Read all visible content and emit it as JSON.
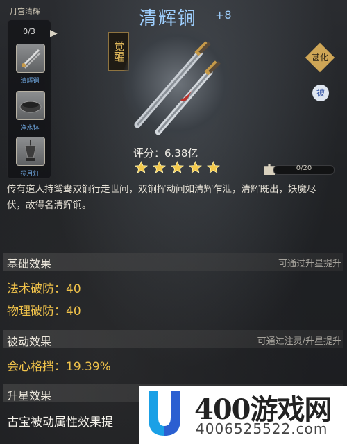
{
  "set": {
    "title": "月宫清辉",
    "count": "0/3",
    "items": [
      {
        "label": "清辉锏"
      },
      {
        "label": "净水钵"
      },
      {
        "label": "揽月灯"
      }
    ]
  },
  "item": {
    "name": "清辉锏",
    "level": "+8",
    "awaken_badge": "觉醒",
    "side_badge_1": "甚化",
    "side_badge_2": "被",
    "score": "评分：6.38亿",
    "stars": 5,
    "progress": "0/20",
    "progress_value": 0,
    "description": "传有道人持鸳鸯双锏行走世间，双锏挥动间如清辉乍泄，清辉既出，妖魔尽伏，故得名清辉锏。"
  },
  "sections": {
    "base": {
      "title": "基础效果",
      "hint": "可通过升星提升",
      "stats": [
        "法术破防：40",
        "物理破防：40"
      ]
    },
    "passive": {
      "title": "被动效果",
      "hint": "可通过注灵/升星提升",
      "stats": [
        "会心格挡：19.39%"
      ]
    },
    "star": {
      "title": "升星效果",
      "text": "古宝被动属性效果提"
    }
  },
  "colors": {
    "title_blue": "#9fd0ff",
    "stat_gold": "#f0c24a",
    "star_gold": "#f3c94c",
    "label_blue": "#6fa7e0"
  },
  "watermark": {
    "brand": "400游戏网",
    "url": "4006525522.com"
  }
}
